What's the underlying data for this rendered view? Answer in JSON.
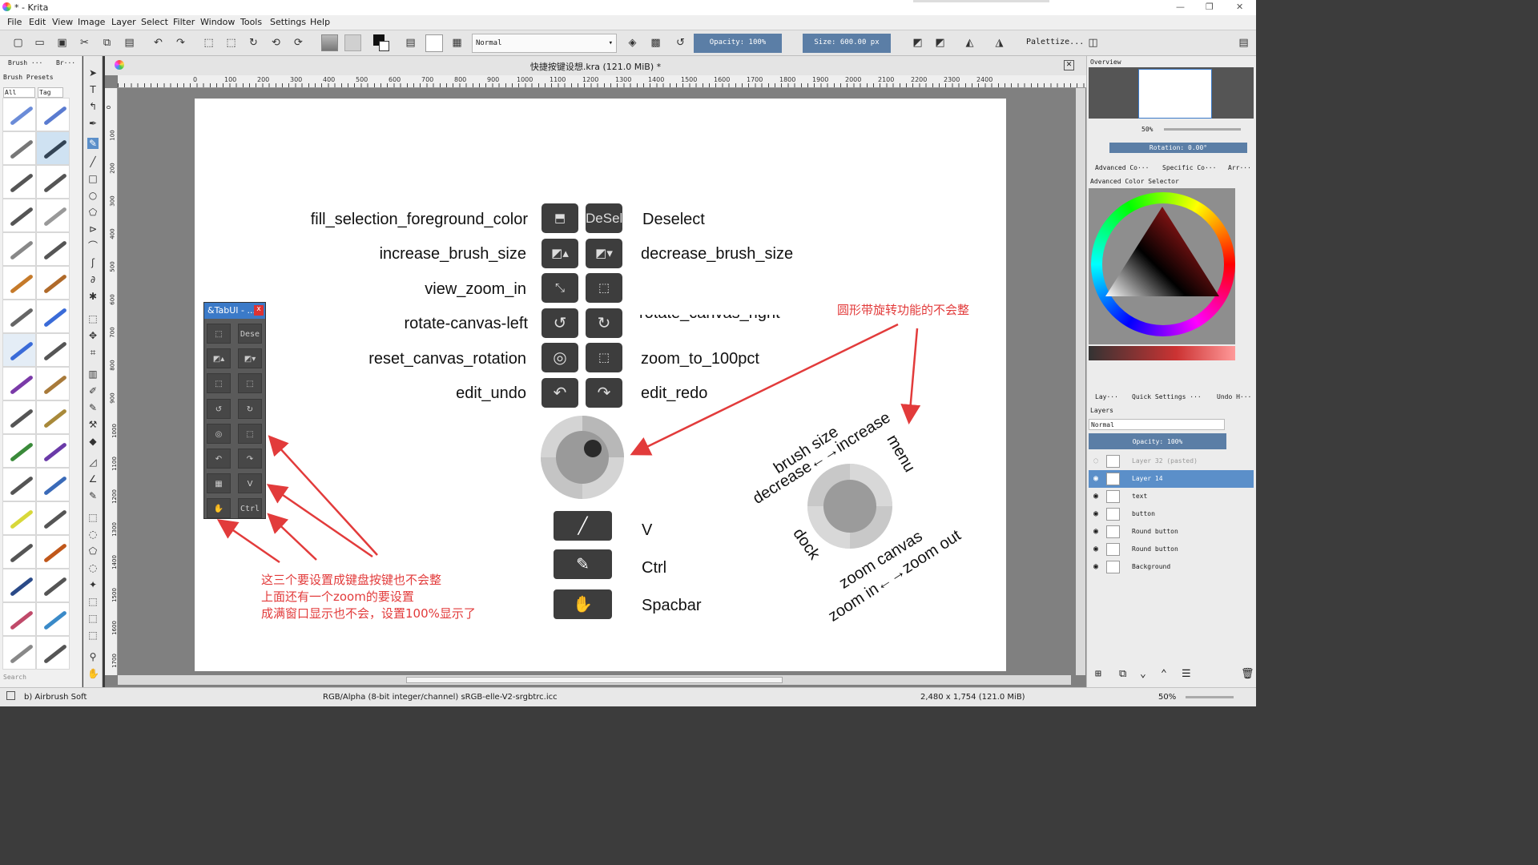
{
  "titlebar": {
    "title": "* - Krita",
    "minimize": "—",
    "restore": "❐",
    "close": "✕"
  },
  "menu": [
    "File",
    "Edit",
    "View",
    "Image",
    "Layer",
    "Select",
    "Filter",
    "Window",
    "Tools",
    "Settings",
    "Help"
  ],
  "toolbar": {
    "blend_mode": "Normal",
    "opacity": "Opacity: 100%",
    "size": "Size: 600.00 px",
    "palette": "Palettize..."
  },
  "left_dock": {
    "tab1": "Brush ···",
    "tab2": "Br···",
    "panel_title": "Brush Presets",
    "filter": "All",
    "tag": "Tag",
    "search": "Search"
  },
  "document": {
    "title": "快捷按键设想.kra (121.0 MiB) *",
    "close": "✕"
  },
  "ruler_h": [
    "0",
    "100",
    "200",
    "300",
    "400",
    "500",
    "600",
    "700",
    "800",
    "900",
    "1000",
    "1100",
    "1200",
    "1300",
    "1400",
    "1500",
    "1600",
    "1700",
    "1800",
    "1900",
    "2000",
    "2100",
    "2200",
    "2300",
    "2400"
  ],
  "ruler_v": [
    "0",
    "100",
    "200",
    "300",
    "400",
    "500",
    "600",
    "700",
    "800",
    "900",
    "1000",
    "1100",
    "1200",
    "1300",
    "1400",
    "1500",
    "1600",
    "1700"
  ],
  "canvas": {
    "left_labels": [
      "fill_selection_foreground_color",
      "increase_brush_size",
      "view_zoom_in",
      "rotate-canvas-left",
      "reset_canvas_rotation",
      "edit_undo"
    ],
    "right_labels": [
      "Deselect",
      "decrease_brush_size",
      "",
      "rotate_canvas_right",
      "zoom_to_100pct",
      "edit_redo"
    ],
    "desel_btn": "DeSel",
    "keys": [
      "V",
      "Ctrl",
      "Spacbar"
    ],
    "dial_texts": {
      "brush_size": "brush size",
      "decrease_increase": "decrease←→increase",
      "menu": "menu",
      "dock": "dock",
      "zoom_canvas": "zoom canvas",
      "zoom_in_out": "zoom in←→zoom out"
    },
    "annotation_top": "圆形带旋转功能的不会整",
    "annotation_bottom": [
      "这三个要设置成键盘按键也不会整",
      "上面还有一个zoom的要设置",
      "成满窗口显示也不会，设置100%显示了"
    ]
  },
  "tabui": {
    "title": "&TabUI - ...",
    "close": "x",
    "buttons": [
      "⬚",
      "Dese",
      "◩▴",
      "◩▾",
      "⬚",
      "⬚",
      "↺",
      "↻",
      "◎",
      "⬚",
      "↶",
      "↷",
      "▦",
      "V",
      "✋",
      "Ctrl"
    ]
  },
  "right_dock": {
    "overview": "Overview",
    "zoom": "50%",
    "rotation": "Rotation: 0.00°",
    "tabs": [
      "Advanced Co···",
      "Specific Co···",
      "Arr···"
    ],
    "color_title": "Advanced Color Selector",
    "layer_tabs": [
      "Lay···",
      "Quick Settings ···",
      "Undo H···"
    ],
    "layers_title": "Layers",
    "blend": "Normal",
    "opacity": "Opacity: 100%",
    "layers": [
      "Layer 32 (pasted)",
      "Layer 14",
      "text",
      "button",
      "Round button",
      "Round button",
      "Background"
    ]
  },
  "status": {
    "brush": "b) Airbrush Soft",
    "color": "RGB/Alpha (8-bit integer/channel)  sRGB-elle-V2-srgbtrc.icc",
    "dims": "2,480 x 1,754 (121.0 MiB)",
    "zoom": "50%"
  },
  "colors": {
    "accent": "#5b7ea6",
    "selected_layer": "#5b8fc9",
    "annotation": "#e23b3b",
    "button": "#3d3d3d"
  }
}
